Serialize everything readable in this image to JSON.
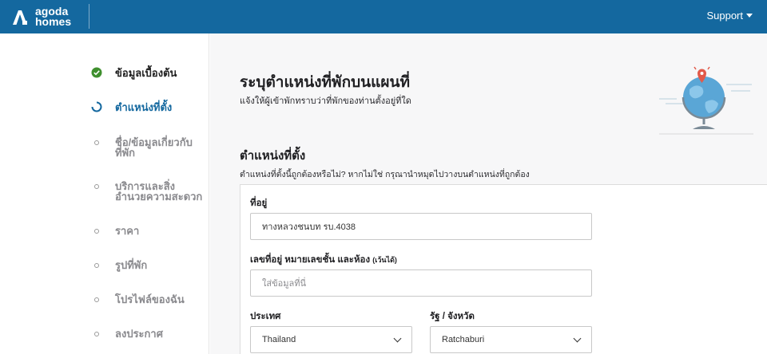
{
  "header": {
    "logo_line1": "agoda",
    "logo_line2": "homes",
    "support_label": "Support",
    "bar_color": "#14689f"
  },
  "sidebar": {
    "steps": [
      {
        "label_line1": "ข้อมูลเบื้องต้น",
        "label_line2": "",
        "state": "done"
      },
      {
        "label_line1": "ตำแหน่งที่ตั้ง",
        "label_line2": "",
        "state": "active"
      },
      {
        "label_line1": "ชื่อ/ข้อมูลเกี่ยวกับ",
        "label_line2": "ที่พัก",
        "state": "todo"
      },
      {
        "label_line1": "บริการและสิ่ง",
        "label_line2": "อำนวยความสะดวก",
        "state": "todo"
      },
      {
        "label_line1": "ราคา",
        "label_line2": "",
        "state": "todo"
      },
      {
        "label_line1": "รูปที่พัก",
        "label_line2": "",
        "state": "todo"
      },
      {
        "label_line1": "โปรไฟล์ของฉัน",
        "label_line2": "",
        "state": "todo"
      },
      {
        "label_line1": "ลงประกาศ",
        "label_line2": "",
        "state": "todo"
      }
    ]
  },
  "main": {
    "title": "ระบุตำแหน่งที่พักบนแผนที่",
    "subtitle": "แจ้งให้ผู้เข้าพักทราบว่าที่พักของท่านตั้งอยู่ที่ใด",
    "section_title": "ตำแหน่งที่ตั้ง",
    "section_desc": "ตำแหน่งที่ตั้งนี้ถูกต้องหรือไม่? หากไม่ใช่ กรุณานำหมุดไปวางบนตำแหน่งที่ถูกต้อง",
    "form": {
      "address_label": "ที่อยู่",
      "address_value": "ทางหลวงชนบท รบ.4038",
      "unit_label": "เลขที่อยู่ หมายเลขชั้น และห้อง",
      "unit_hint": "(เว้นได้)",
      "unit_placeholder": "ใส่ข้อมูลที่นี่",
      "country_label": "ประเทศ",
      "country_value": "Thailand",
      "province_label": "รัฐ / จังหวัด",
      "province_value": "Ratchaburi"
    }
  },
  "icons": {
    "done_step": "check-circle-icon",
    "active_step": "progress-ring-icon",
    "todo_step": "empty-dot-icon",
    "illustration": "globe-pin-icon"
  },
  "colors": {
    "accent": "#14689f",
    "done": "#3f8f2e"
  }
}
